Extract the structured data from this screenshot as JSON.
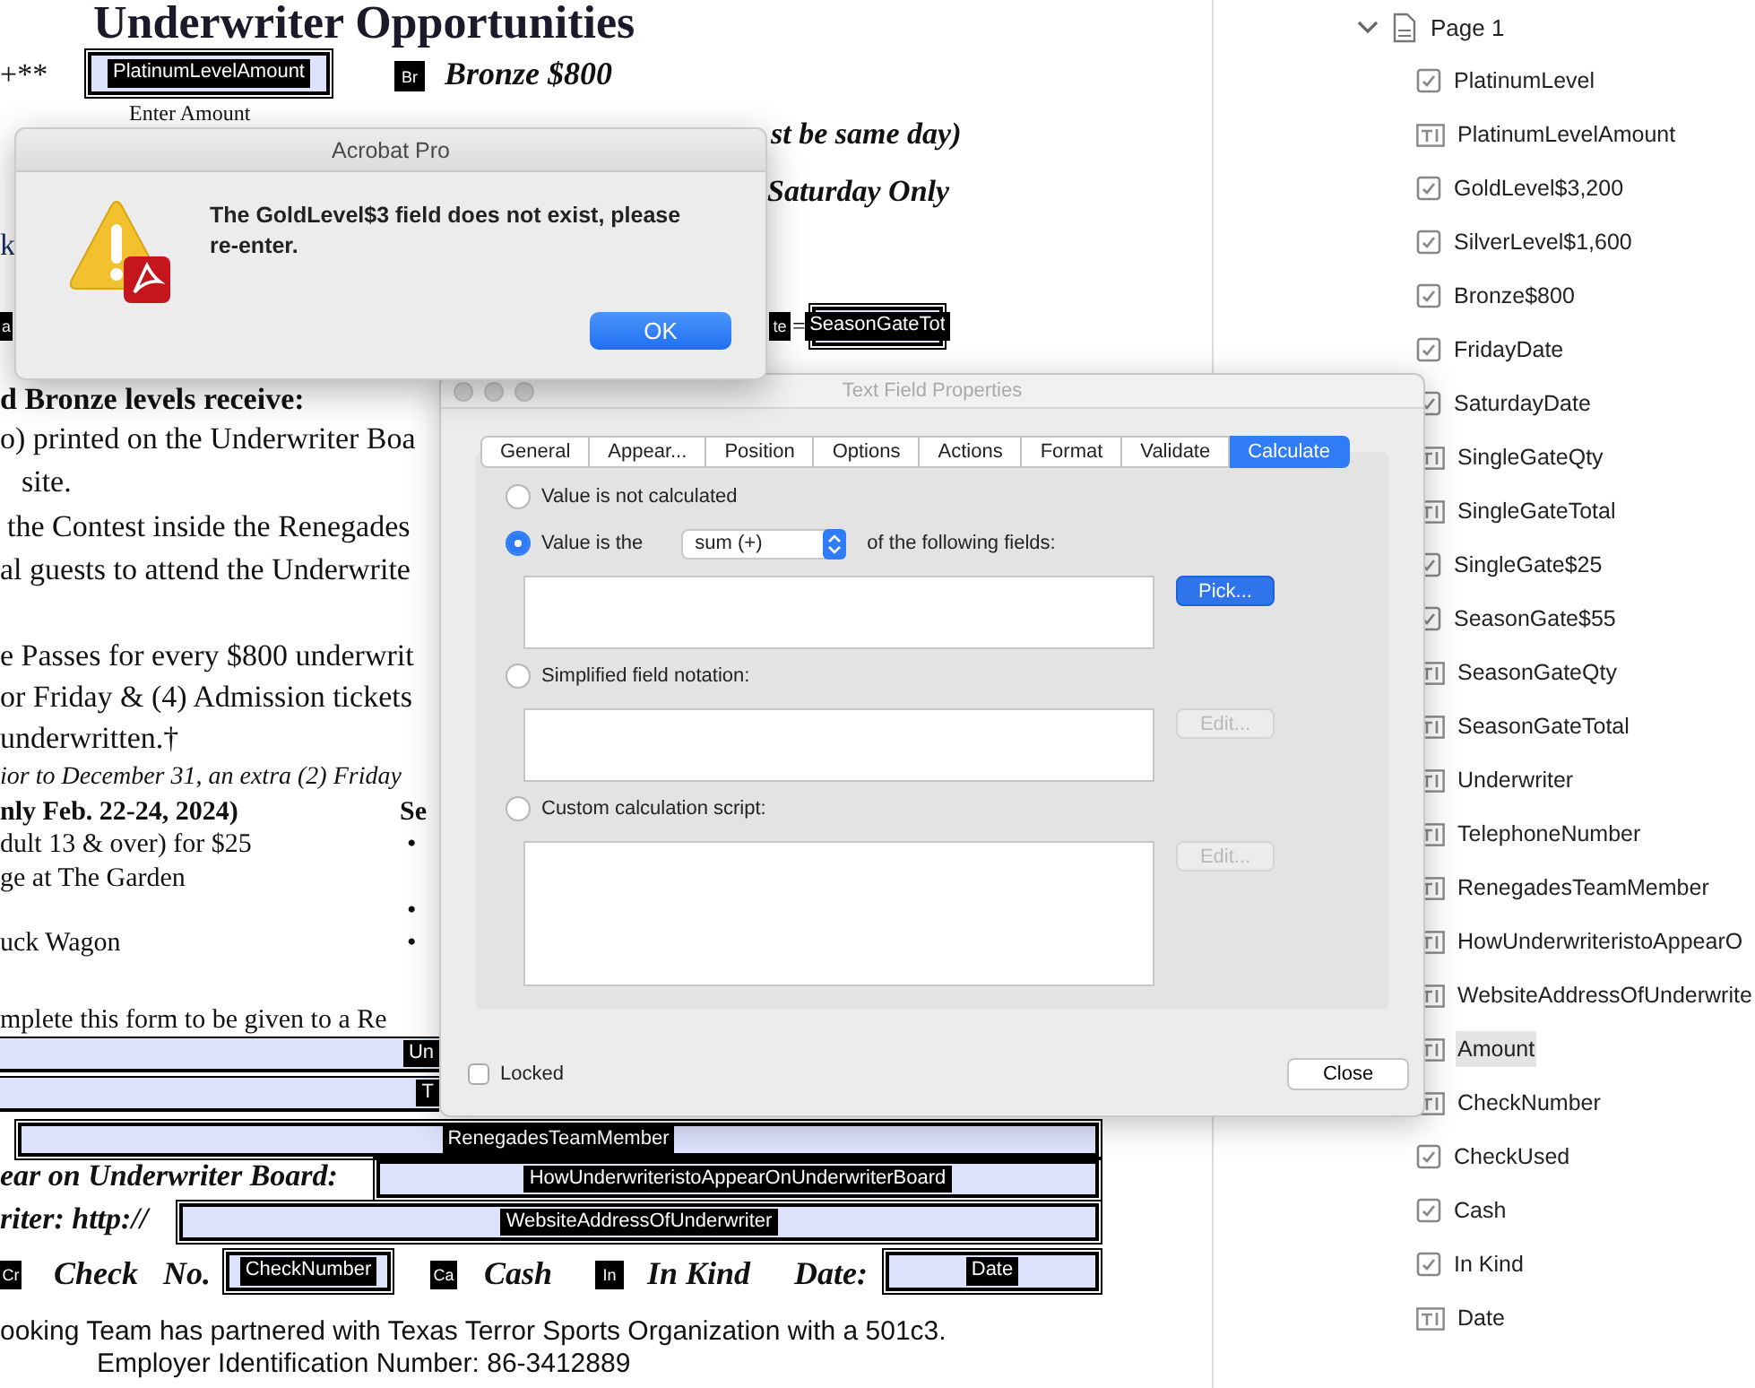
{
  "document": {
    "items": [
      {
        "kind": "heading",
        "text": "**Underwriter Opportunities**"
      },
      {
        "kind": "body",
        "text": "+**"
      },
      {
        "kind": "field",
        "text": "PlatinumLevelAmount"
      },
      {
        "kind": "tag",
        "text": "Br"
      },
      {
        "kind": "emph",
        "text": "**Bronze $800**"
      },
      {
        "kind": "body",
        "text": "Enter Amount"
      },
      {
        "kind": "emph",
        "text": "**st be same day)**"
      },
      {
        "kind": "emph",
        "text": "**Saturday Only**"
      },
      {
        "kind": "link",
        "text": "k"
      },
      {
        "kind": "tag",
        "text": "a"
      },
      {
        "kind": "tag",
        "text": "te"
      },
      {
        "kind": "body",
        "text": "="
      },
      {
        "kind": "field",
        "text": "SeasonGateTot"
      },
      {
        "kind": "bold",
        "text": "**d Bronze levels receive:**"
      },
      {
        "kind": "body",
        "text": "o) printed on the Underwriter Boa"
      },
      {
        "kind": "body",
        "text": "site."
      },
      {
        "kind": "body",
        "text": "the Contest inside the Renegades"
      },
      {
        "kind": "body",
        "text": "al guests to attend the Underwrite"
      },
      {
        "kind": "body",
        "text": "e Passes for every $800 underwrit"
      },
      {
        "kind": "body",
        "text": "or Friday & (4) Admission tickets"
      },
      {
        "kind": "body",
        "text": "underwritten.†"
      },
      {
        "kind": "note",
        "text": "ior to December 31, an extra (2) Friday"
      },
      {
        "kind": "bold",
        "text": "**nly Feb. 22-24, 2024)**"
      },
      {
        "kind": "bold",
        "text": "**Se**"
      },
      {
        "kind": "body",
        "text": "dult 13 & over) for $25"
      },
      {
        "kind": "bullet",
        "text": "•"
      },
      {
        "kind": "body",
        "text": "ge at The Garden"
      },
      {
        "kind": "bullet",
        "text": "•"
      },
      {
        "kind": "body",
        "text": "uck Wagon"
      },
      {
        "kind": "bullet",
        "text": "•"
      },
      {
        "kind": "body",
        "text": "mplete this form to be given to a Re"
      },
      {
        "kind": "fieldcut",
        "text": "Un"
      },
      {
        "kind": "fieldcut",
        "text": "T"
      },
      {
        "kind": "field",
        "text": "RenegadesTeamMember"
      },
      {
        "kind": "emph",
        "text": "**ear on Underwriter Board:**"
      },
      {
        "kind": "field",
        "text": "HowUnderwriteristoAppearOnUnderwriterBoard"
      },
      {
        "kind": "emph",
        "text": "**riter: http://**"
      },
      {
        "kind": "field",
        "text": "WebsiteAddressOfUnderwriter"
      },
      {
        "kind": "tag",
        "text": "Cr"
      },
      {
        "kind": "emph",
        "text": "**Check**"
      },
      {
        "kind": "emph",
        "text": "**No.**"
      },
      {
        "kind": "field",
        "text": "CheckNumber"
      },
      {
        "kind": "tag",
        "text": "Ca"
      },
      {
        "kind": "emph",
        "text": "**Cash**"
      },
      {
        "kind": "tag",
        "text": "In"
      },
      {
        "kind": "emph",
        "text": "**In Kind**"
      },
      {
        "kind": "emph",
        "text": "**Date:**"
      },
      {
        "kind": "field",
        "text": "Date"
      },
      {
        "kind": "sans",
        "text": "ooking Team has partnered with Texas Terror Sports Organization with a 501c3."
      },
      {
        "kind": "sans",
        "text": "Employer Identification Number: 86-3412889"
      }
    ]
  },
  "fields_panel": {
    "page": {
      "label": "Page 1",
      "expanded": true
    },
    "fields": [
      {
        "name": "PlatinumLevel",
        "kind": "checkbox",
        "selected": false
      },
      {
        "name": "PlatinumLevelAmount",
        "kind": "text",
        "selected": false
      },
      {
        "name": "GoldLevel$3,200",
        "kind": "checkbox",
        "selected": false
      },
      {
        "name": "SilverLevel$1,600",
        "kind": "checkbox",
        "selected": false
      },
      {
        "name": "Bronze$800",
        "kind": "checkbox",
        "selected": false
      },
      {
        "name": "FridayDate",
        "kind": "checkbox",
        "selected": false
      },
      {
        "name": "SaturdayDate",
        "kind": "checkbox",
        "selected": false
      },
      {
        "name": "SingleGateQty",
        "kind": "text",
        "selected": false
      },
      {
        "name": "SingleGateTotal",
        "kind": "text",
        "selected": false
      },
      {
        "name": "SingleGate$25",
        "kind": "checkbox",
        "selected": false
      },
      {
        "name": "SeasonGate$55",
        "kind": "checkbox",
        "selected": false
      },
      {
        "name": "SeasonGateQty",
        "kind": "text",
        "selected": false
      },
      {
        "name": "SeasonGateTotal",
        "kind": "text",
        "selected": false
      },
      {
        "name": "Underwriter",
        "kind": "text",
        "selected": false
      },
      {
        "name": "TelephoneNumber",
        "kind": "text",
        "selected": false
      },
      {
        "name": "RenegadesTeamMember",
        "kind": "text",
        "selected": false
      },
      {
        "name": "HowUnderwriteristoAppearO",
        "kind": "text",
        "selected": false
      },
      {
        "name": "WebsiteAddressOfUnderwrite",
        "kind": "text",
        "selected": false
      },
      {
        "name": "Amount",
        "kind": "text",
        "selected": true
      },
      {
        "name": "CheckNumber",
        "kind": "text",
        "selected": false
      },
      {
        "name": "CheckUsed",
        "kind": "checkbox",
        "selected": false
      },
      {
        "name": "Cash",
        "kind": "checkbox",
        "selected": false
      },
      {
        "name": "In Kind",
        "kind": "checkbox",
        "selected": false
      },
      {
        "name": "Date",
        "kind": "text",
        "selected": false
      }
    ]
  },
  "alert": {
    "title": "Acrobat Pro",
    "message": "The GoldLevel$3 field does not exist, please re-enter.",
    "button": "OK"
  },
  "properties": {
    "title": "Text Field Properties",
    "tabs": [
      {
        "label": "General",
        "selected": false
      },
      {
        "label": "Appear...",
        "selected": false
      },
      {
        "label": "Position",
        "selected": false
      },
      {
        "label": "Options",
        "selected": false
      },
      {
        "label": "Actions",
        "selected": false
      },
      {
        "label": "Format",
        "selected": false
      },
      {
        "label": "Validate",
        "selected": false
      },
      {
        "label": "Calculate",
        "selected": true
      }
    ],
    "options": [
      {
        "kind": "plain",
        "label": "Value is not calculated",
        "selected": false
      },
      {
        "kind": "operation",
        "label": "Value is the",
        "selected": true,
        "operation": "sum (+)",
        "suffix": "of the following fields:",
        "button": {
          "label": "Pick...",
          "disabled": false
        }
      },
      {
        "kind": "notation",
        "label": "Simplified field notation:",
        "selected": false,
        "button": {
          "label": "Edit...",
          "disabled": true
        }
      },
      {
        "kind": "script",
        "label": "Custom calculation script:",
        "selected": false,
        "button": {
          "label": "Edit...",
          "disabled": true
        }
      }
    ],
    "locked": {
      "label": "Locked",
      "checked": false
    },
    "close": "Close"
  }
}
